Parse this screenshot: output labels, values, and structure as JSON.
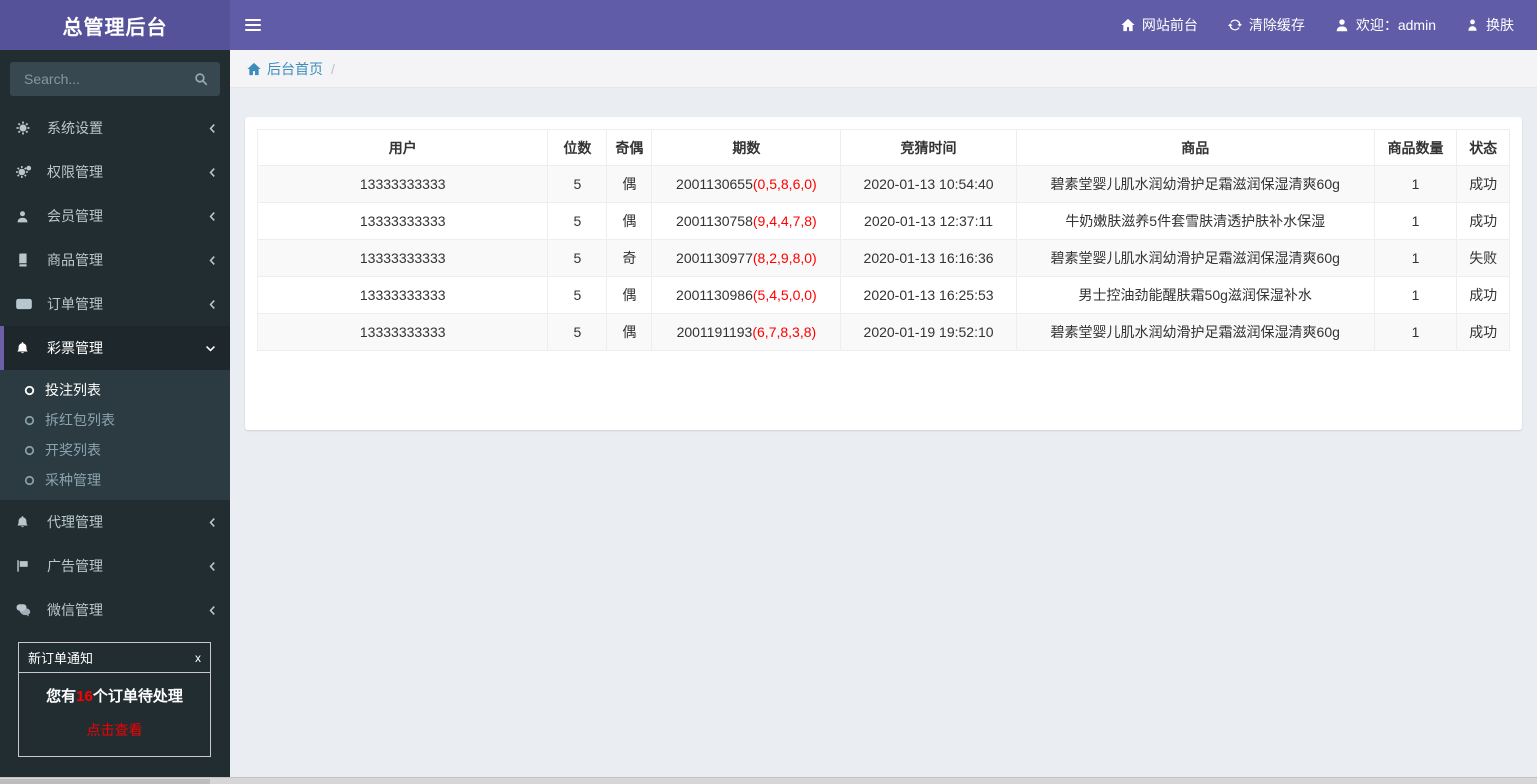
{
  "app": {
    "title": "总管理后台"
  },
  "topbar": {
    "items": [
      {
        "icon": "home-icon",
        "label": "网站前台"
      },
      {
        "icon": "refresh-icon",
        "label": "清除缓存"
      },
      {
        "icon": "user-icon",
        "label": "欢迎：admin"
      },
      {
        "icon": "skin-icon",
        "label": "换肤"
      }
    ]
  },
  "sidebar": {
    "search_placeholder": "Search...",
    "items": [
      {
        "icon": "gear-icon",
        "label": "系统设置"
      },
      {
        "icon": "cogs-icon",
        "label": "权限管理"
      },
      {
        "icon": "user-icon",
        "label": "会员管理"
      },
      {
        "icon": "book-icon",
        "label": "商品管理"
      },
      {
        "icon": "money-icon",
        "label": "订单管理"
      },
      {
        "icon": "bell-icon",
        "label": "彩票管理",
        "children": [
          {
            "icon": "circle-icon",
            "label": "投注列表"
          },
          {
            "icon": "circle-icon",
            "label": "拆红包列表"
          },
          {
            "icon": "circle-icon",
            "label": "开奖列表"
          },
          {
            "icon": "circle-icon",
            "label": "采种管理"
          }
        ]
      },
      {
        "icon": "bell-icon",
        "label": "代理管理"
      },
      {
        "icon": "flag-icon",
        "label": "广告管理"
      },
      {
        "icon": "comments-icon",
        "label": "微信管理"
      }
    ]
  },
  "breadcrumb": {
    "home": "后台首页",
    "separator": "/"
  },
  "table": {
    "headers": [
      "用户",
      "位数",
      "奇偶",
      "期数",
      "竞猜时间",
      "商品",
      "商品数量",
      "状态"
    ],
    "rows": [
      {
        "user": "13333333333",
        "digits": "5",
        "parity": "偶",
        "period": "2001130655",
        "numbers": "(0,5,8,6,0)",
        "time": "2020-01-13 10:54:40",
        "product": "碧素堂婴儿肌水润幼滑护足霜滋润保湿清爽60g",
        "qty": "1",
        "status": "成功"
      },
      {
        "user": "13333333333",
        "digits": "5",
        "parity": "偶",
        "period": "2001130758",
        "numbers": "(9,4,4,7,8)",
        "time": "2020-01-13 12:37:11",
        "product": "牛奶嫩肤滋养5件套雪肤清透护肤补水保湿",
        "qty": "1",
        "status": "成功"
      },
      {
        "user": "13333333333",
        "digits": "5",
        "parity": "奇",
        "period": "2001130977",
        "numbers": "(8,2,9,8,0)",
        "time": "2020-01-13 16:16:36",
        "product": "碧素堂婴儿肌水润幼滑护足霜滋润保湿清爽60g",
        "qty": "1",
        "status": "失败"
      },
      {
        "user": "13333333333",
        "digits": "5",
        "parity": "偶",
        "period": "2001130986",
        "numbers": "(5,4,5,0,0)",
        "time": "2020-01-13 16:25:53",
        "product": "男士控油劲能醒肤霜50g滋润保湿补水",
        "qty": "1",
        "status": "成功"
      },
      {
        "user": "13333333333",
        "digits": "5",
        "parity": "偶",
        "period": "2001191193",
        "numbers": "(6,7,8,3,8)",
        "time": "2020-01-19 19:52:10",
        "product": "碧素堂婴儿肌水润幼滑护足霜滋润保湿清爽60g",
        "qty": "1",
        "status": "成功"
      }
    ]
  },
  "notification": {
    "title": "新订单通知",
    "close": "x",
    "message_prefix": "您有",
    "message_count": "16",
    "message_suffix": "个订单待处理",
    "action": "点击查看"
  },
  "colors": {
    "navbar": "#605ca8",
    "logo": "#555299",
    "sidebar": "#222d32",
    "submenu": "#2c3b41",
    "active_border": "#6a5fa8",
    "link_blue": "#3c8dbc",
    "alert_red": "#ff0000"
  }
}
